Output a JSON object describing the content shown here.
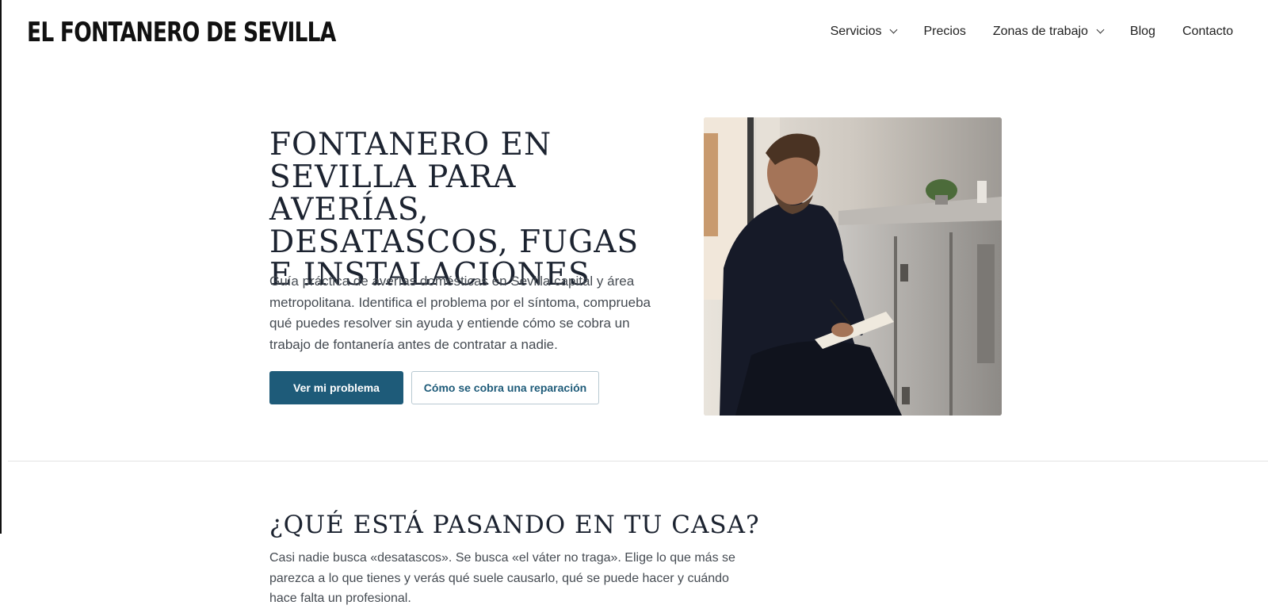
{
  "header": {
    "logo": "EL FONTANERO DE SEVILLA",
    "nav": [
      {
        "label": "Servicios",
        "has_dropdown": true
      },
      {
        "label": "Precios",
        "has_dropdown": false
      },
      {
        "label": "Zonas de trabajo",
        "has_dropdown": true
      },
      {
        "label": "Blog",
        "has_dropdown": false
      },
      {
        "label": "Contacto",
        "has_dropdown": false
      }
    ]
  },
  "hero": {
    "title_lines": [
      "FONTANERO EN",
      "SEVILLA PARA AVERÍAS,",
      "DESATASCOS, FUGAS",
      "E INSTALACIONES"
    ],
    "text": "Guía práctica de averías domésticas en Sevilla capital y área metropolitana. Identifica el problema por el síntoma, comprueba qué puedes resolver sin ayuda y entiende cómo se cobra un trabajo de fontanería antes de contratar a nadie.",
    "primary_button": "Ver mi problema",
    "secondary_button": "Cómo se cobra una reparación"
  },
  "section": {
    "title": "¿QUÉ ESTÁ PASANDO EN TU CASA?",
    "text": "Casi nadie busca «desatascos». Se busca «el váter no traga». Elige lo que más se parezca a lo que tienes y verás qué suele causarlo, qué se puede hacer y cuándo hace falta un profesional."
  },
  "colors": {
    "accent": "#1e5b79",
    "heading": "#1c2330",
    "body_text": "#454b52"
  }
}
